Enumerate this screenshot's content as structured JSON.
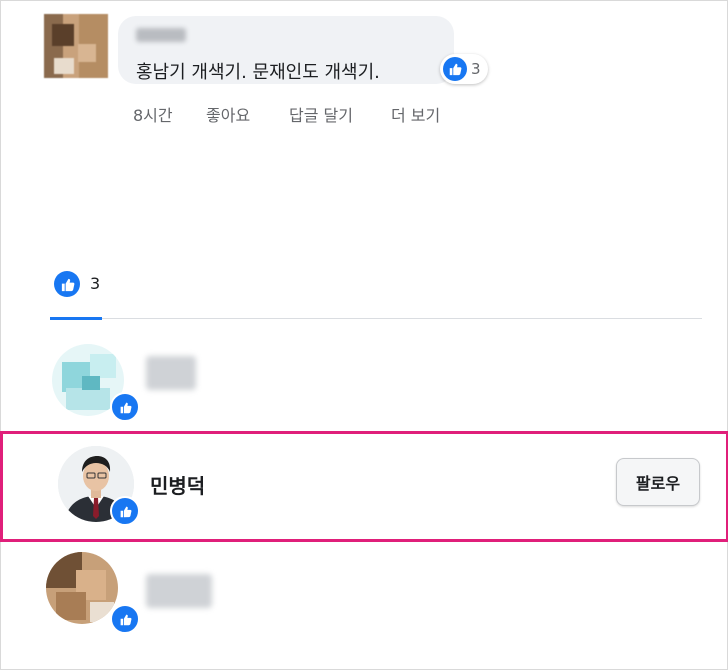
{
  "comment": {
    "text": "홍남기 개색기. 문재인도 개색기.",
    "reaction_count": "3",
    "actions": {
      "time": "8시간",
      "like": "좋아요",
      "reply": "답글 달기",
      "more": "더 보기"
    }
  },
  "reactions_tab": {
    "icon": "like-icon",
    "count": "3"
  },
  "people": [
    {
      "name": "",
      "blurred": true,
      "reaction": "like"
    },
    {
      "name": "민병덕",
      "blurred": false,
      "reaction": "like",
      "follow_label": "팔로우",
      "highlighted": true
    },
    {
      "name": "",
      "blurred": true,
      "reaction": "like"
    }
  ],
  "colors": {
    "accent": "#1877f2",
    "highlight_border": "#e01f7a",
    "bubble_bg": "#f0f2f5",
    "muted_text": "#65676b"
  }
}
